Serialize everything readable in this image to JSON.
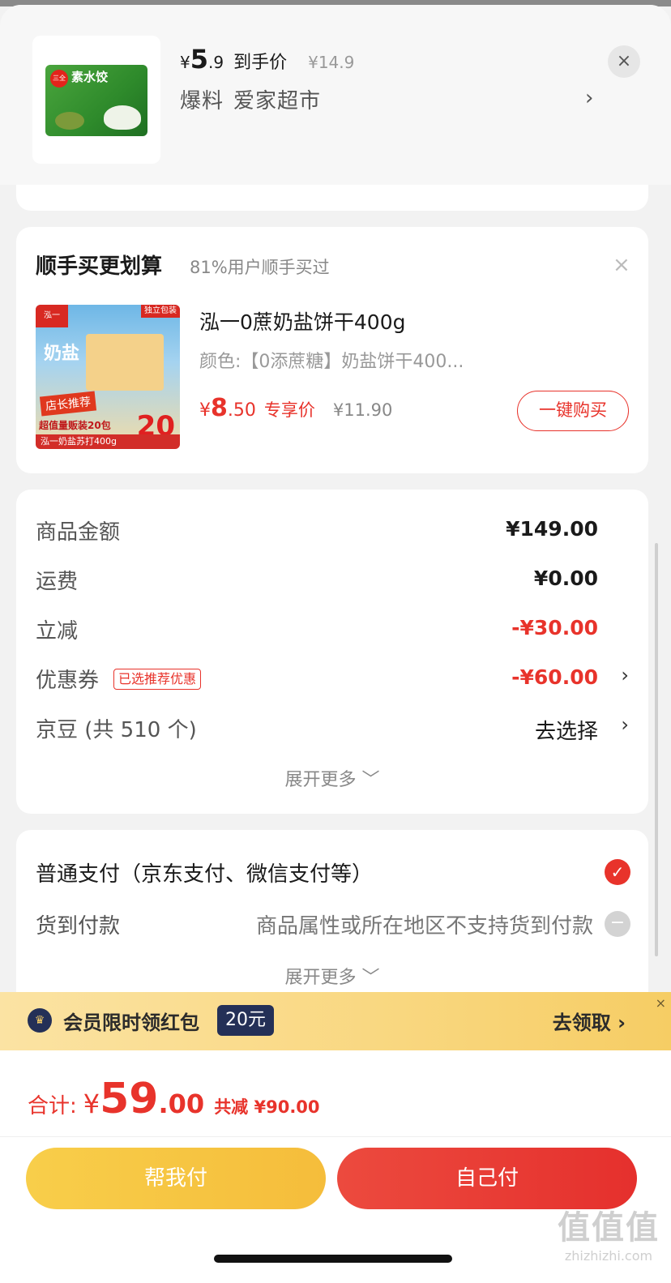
{
  "header": {
    "price_currency": "¥",
    "price_int": "5",
    "price_dec": ".9",
    "price_tag": "到手价",
    "orig_price": "¥14.9",
    "sub1": "爆料",
    "sub2": "爱家超市",
    "chevron": "›",
    "close": "×",
    "thumb": {
      "brand": "三全",
      "title": "素水饺"
    }
  },
  "buy_together": {
    "title": "顺手买更划算",
    "subtitle": "81%用户顺手买过",
    "close": "×",
    "product": {
      "name": "泓一0蔗奶盐饼干400g",
      "variant": "颜色:【0添蔗糖】奶盐饼干400...",
      "price_currency": "¥",
      "price_int": "8",
      "price_dec": ".50",
      "price_tag": "专享价",
      "orig_price": "¥11.90",
      "buy_button": "一键购买",
      "img": {
        "t1": "泓一",
        "t2": "独立包装",
        "t3": "奶盐",
        "t4": "店长推荐",
        "t5": "超值量贩装20包",
        "t6": "20",
        "t7": "泓一奶盐苏打400g"
      }
    }
  },
  "summary": {
    "rows": [
      {
        "label": "商品金额",
        "value": "¥149.00"
      },
      {
        "label": "运费",
        "value": "¥0.00"
      },
      {
        "label": "立减",
        "value": "-¥30.00"
      },
      {
        "label": "优惠券",
        "badge": "已选推荐优惠",
        "value": "-¥60.00",
        "chevron": "›"
      },
      {
        "label": "京豆 (共 510 个)",
        "value": "去选择",
        "chevron": "›"
      }
    ],
    "expand": "展开更多 ﹀"
  },
  "payment": {
    "normal": "普通支付（京东支付、微信支付等）",
    "cod": "货到付款",
    "cod_note": "商品属性或所在地区不支持货到付款",
    "check": "✓",
    "minus": "−",
    "expand": "展开更多 ﹀"
  },
  "member_banner": {
    "text": "会员限时领红包",
    "amount": "20元",
    "cta": "去领取 ›",
    "crown": "♛",
    "close": "×"
  },
  "bottom": {
    "total_label": "合计:",
    "total_currency": "¥",
    "total_int": "59",
    "total_dec": ".00",
    "saved": "共减 ¥90.00",
    "help_pay": "帮我付",
    "self_pay": "自己付",
    "watermark1": "值值值",
    "watermark2": "zhizhizhi.com"
  },
  "colors": {
    "accent": "#e8332b",
    "gold": "#f5bd3b",
    "navy": "#243057"
  }
}
